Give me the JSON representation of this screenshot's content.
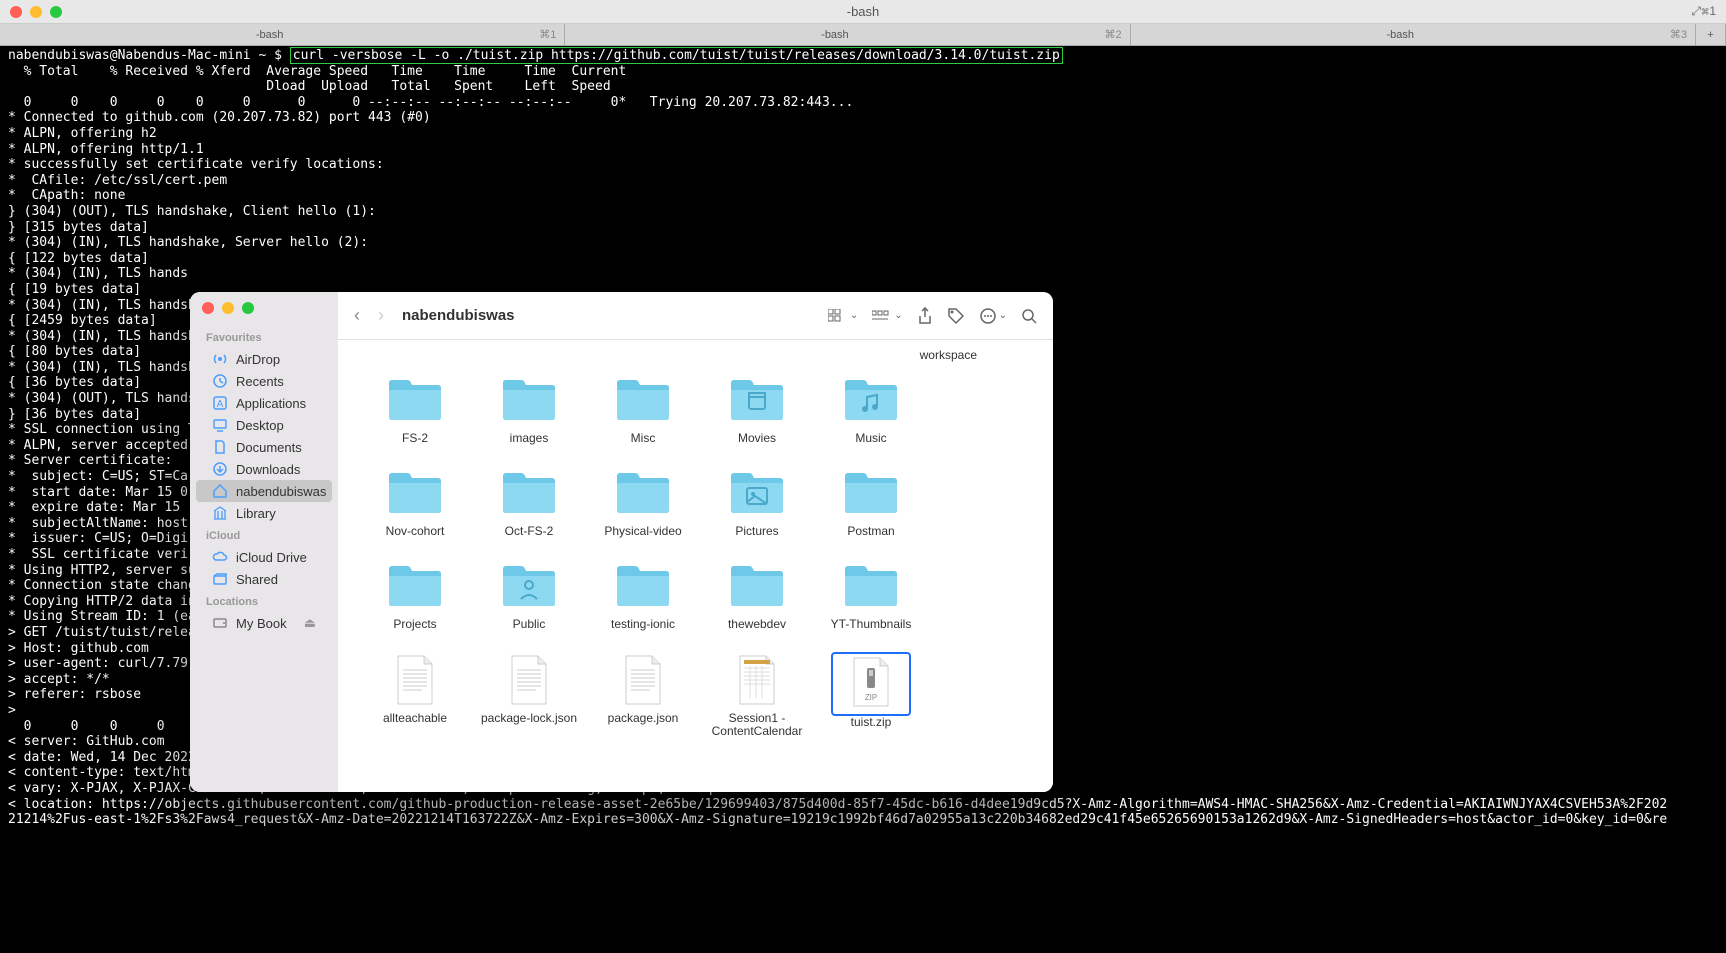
{
  "window": {
    "title": "-bash",
    "fullscreen_hint": "⤢⌘1"
  },
  "tabs": [
    {
      "label": "-bash",
      "shortcut": "⌘1"
    },
    {
      "label": "-bash",
      "shortcut": "⌘2"
    },
    {
      "label": "-bash",
      "shortcut": "⌘3"
    }
  ],
  "terminal": {
    "prompt": "nabendubiswas@Nabendus-Mac-mini ~ $ ",
    "command": "curl -versbose -L -o ./tuist.zip https://github.com/tuist/tuist/releases/download/3.14.0/tuist.zip",
    "output": "  % Total    % Received % Xferd  Average Speed   Time    Time     Time  Current\n                                 Dload  Upload   Total   Spent    Left  Speed\n  0     0    0     0    0     0      0      0 --:--:-- --:--:-- --:--:--     0*   Trying 20.207.73.82:443...\n* Connected to github.com (20.207.73.82) port 443 (#0)\n* ALPN, offering h2\n* ALPN, offering http/1.1\n* successfully set certificate verify locations:\n*  CAfile: /etc/ssl/cert.pem\n*  CApath: none\n} (304) (OUT), TLS handshake, Client hello (1):\n} [315 bytes data]\n* (304) (IN), TLS handshake, Server hello (2):\n{ [122 bytes data]\n* (304) (IN), TLS hands\n{ [19 bytes data]\n* (304) (IN), TLS handsh\n{ [2459 bytes data]\n* (304) (IN), TLS handsh\n{ [80 bytes data]\n* (304) (IN), TLS handsh\n{ [36 bytes data]\n* (304) (OUT), TLS hands\n} [36 bytes data]\n* SSL connection using T\n* ALPN, server accepted \n* Server certificate:\n*  subject: C=US; ST=Ca\n*  start date: Mar 15 0\n*  expire date: Mar 15 \n*  subjectAltName: host\n*  issuer: C=US; O=Digi\n*  SSL certificate veri\n* Using HTTP2, server su\n* Connection state chang\n* Copying HTTP/2 data in\n* Using Stream ID: 1 (ea\n> GET /tuist/tuist/relea\n> Host: github.com\n> user-agent: curl/7.79\n> accept: */*\n> referer: rsbose\n>\n  0     0    0     0    0\n< server: GitHub.com\n< date: Wed, 14 Dec 2022 16:37:22 GMT\n< content-type: text/html; charset=utf-8\n< vary: X-PJAX, X-PJAX-Container, Turbo-Visit, Turbo-Frame, Accept-Encoding, Accept, X-Requested-With\n< location: https://objects.githubusercontent.com/github-production-release-asset-2e65be/129699403/875d400d-85f7-45dc-b616-d4dee19d9cd5?X-Amz-Algorithm=AWS4-HMAC-SHA256&X-Amz-Credential=AKIAIWNJYAX4CSVEH53A%2F202\n21214%2Fus-east-1%2Fs3%2Faws4_request&X-Amz-Date=20221214T163722Z&X-Amz-Expires=300&X-Amz-Signature=19219c1992bf46d7a02955a13c220b34682ed29c41f45e65265690153a1262d9&X-Amz-SignedHeaders=host&actor_id=0&key_id=0&re"
  },
  "finder": {
    "title": "nabendubiswas",
    "extra_caption": "workspace",
    "sidebar": {
      "favourites_label": "Favourites",
      "icloud_label": "iCloud",
      "locations_label": "Locations",
      "items": [
        {
          "icon": "airdrop",
          "label": "AirDrop"
        },
        {
          "icon": "recents",
          "label": "Recents"
        },
        {
          "icon": "applications",
          "label": "Applications"
        },
        {
          "icon": "desktop",
          "label": "Desktop"
        },
        {
          "icon": "documents",
          "label": "Documents"
        },
        {
          "icon": "downloads",
          "label": "Downloads"
        },
        {
          "icon": "home",
          "label": "nabendubiswas",
          "active": true
        },
        {
          "icon": "library",
          "label": "Library"
        }
      ],
      "icloud_items": [
        {
          "icon": "icloud",
          "label": "iCloud Drive"
        },
        {
          "icon": "shared",
          "label": "Shared"
        }
      ],
      "location_items": [
        {
          "icon": "disk",
          "label": "My Book",
          "eject": true
        }
      ]
    },
    "files": [
      {
        "type": "folder",
        "label": "FS-2"
      },
      {
        "type": "folder",
        "label": "images"
      },
      {
        "type": "folder",
        "label": "Misc"
      },
      {
        "type": "folder-movies",
        "label": "Movies"
      },
      {
        "type": "folder-music",
        "label": "Music"
      },
      {
        "type": "folder",
        "label": "Nov-cohort"
      },
      {
        "type": "folder",
        "label": "Oct-FS-2"
      },
      {
        "type": "folder",
        "label": "Physical-video"
      },
      {
        "type": "folder-pictures",
        "label": "Pictures"
      },
      {
        "type": "folder",
        "label": "Postman"
      },
      {
        "type": "folder",
        "label": "Projects"
      },
      {
        "type": "folder-public",
        "label": "Public"
      },
      {
        "type": "folder",
        "label": "testing-ionic"
      },
      {
        "type": "folder",
        "label": "thewebdev"
      },
      {
        "type": "folder",
        "label": "YT-Thumbnails"
      },
      {
        "type": "doc",
        "label": "allteachable"
      },
      {
        "type": "doc",
        "label": "package-lock.json"
      },
      {
        "type": "doc",
        "label": "package.json"
      },
      {
        "type": "doc-grid",
        "label": "Session1 - ContentCalendar"
      },
      {
        "type": "zip",
        "label": "tuist.zip",
        "selected": true
      }
    ]
  }
}
